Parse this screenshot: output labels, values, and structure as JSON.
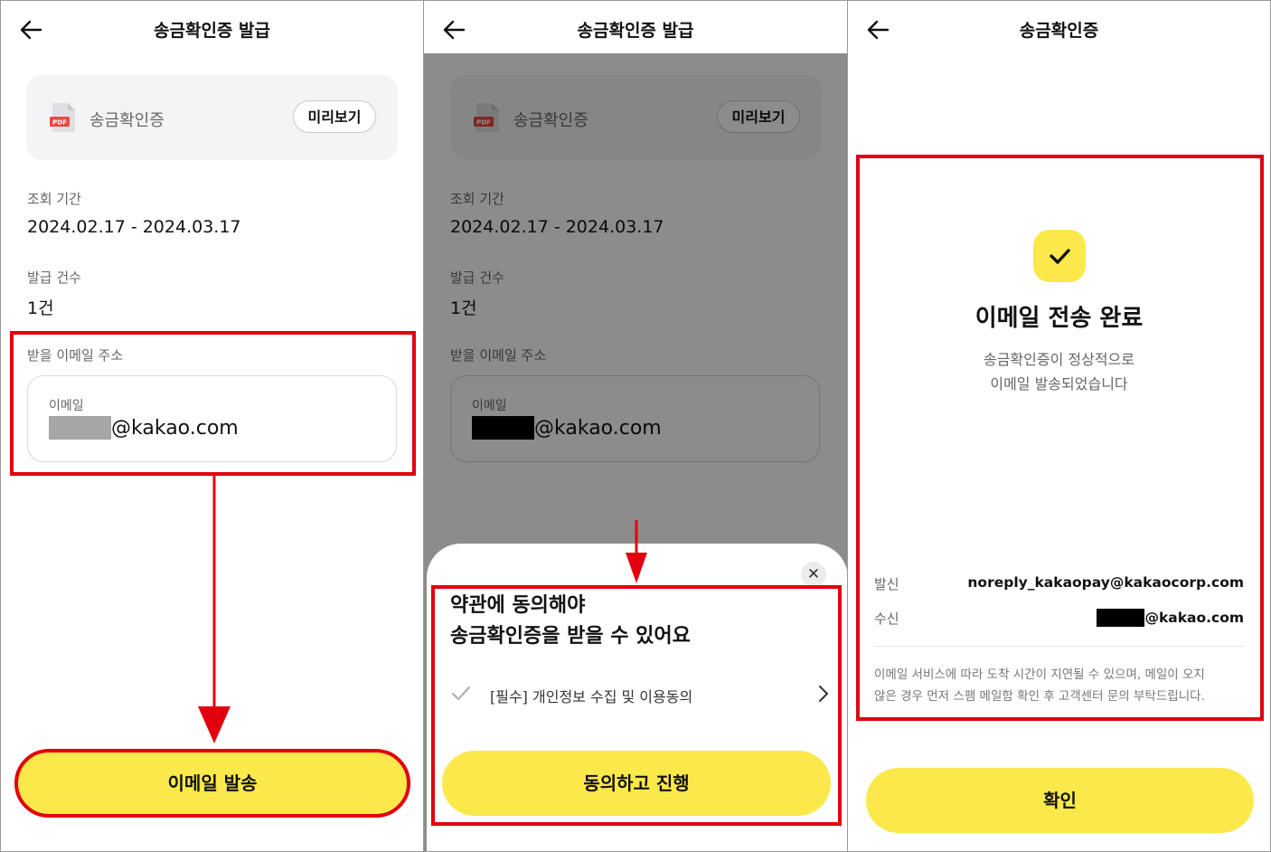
{
  "screen1": {
    "title": "송금확인증 발급",
    "card_name": "송금확인증",
    "pdf_label": "PDF",
    "preview_button": "미리보기",
    "period_label": "조회 기간",
    "period_value": "2024.02.17 - 2024.03.17",
    "count_label": "발급 건수",
    "count_value": "1건",
    "email_section_label": "받을 이메일 주소",
    "email_field_label": "이메일",
    "email_domain": "@kakao.com",
    "send_button": "이메일 발송"
  },
  "screen2": {
    "title": "송금확인증 발급",
    "card_name": "송금확인증",
    "pdf_label": "PDF",
    "preview_button": "미리보기",
    "period_label": "조회 기간",
    "period_value": "2024.02.17 - 2024.03.17",
    "count_label": "발급 건수",
    "count_value": "1건",
    "email_section_label": "받을 이메일 주소",
    "email_field_label": "이메일",
    "email_domain": "@kakao.com",
    "sheet": {
      "title_line1": "약관에 동의해야",
      "title_line2": "송금확인증을 받을 수 있어요",
      "term_label": "[필수] 개인정보 수집 및 이용동의",
      "agree_button": "동의하고 진행"
    }
  },
  "screen3": {
    "title": "송금확인증",
    "heading": "이메일 전송 완료",
    "desc_line1": "송금확인증이 정상적으로",
    "desc_line2": "이메일 발송되었습니다",
    "sender_label": "발신",
    "sender_value": "noreply_kakaopay@kakaocorp.com",
    "recipient_label": "수신",
    "recipient_domain": "@kakao.com",
    "notice_line1": "이메일 서비스에 따라 도착 시간이 지연될 수 있으며, 메일이 오지",
    "notice_line2": "않은 경우 먼저 스팸 메일함 확인 후 고객센터 문의 부탁드립니다.",
    "confirm_button": "확인"
  },
  "colors": {
    "accent_yellow": "#fbe84b",
    "highlight_red": "#e3000e",
    "pdf_red": "#e8493f"
  },
  "icons": [
    "back-arrow-icon",
    "pdf-file-icon",
    "close-icon",
    "checkmark-icon",
    "chevron-right-icon",
    "success-check-icon"
  ]
}
